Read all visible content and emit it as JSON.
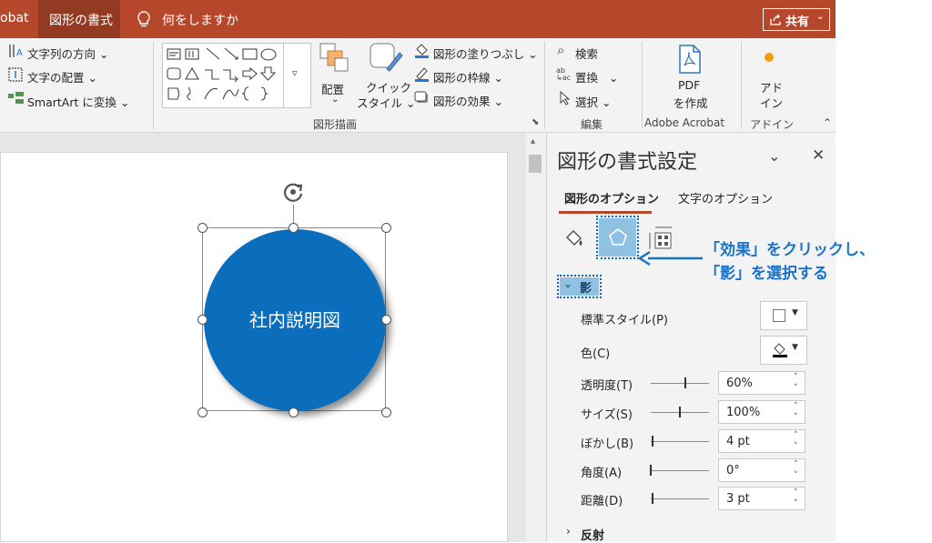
{
  "titlebar": {
    "tab_partial": "obat",
    "tab_active": "図形の書式",
    "tell_me": "何をしますか",
    "share": "共有"
  },
  "ribbon": {
    "text_direction": "文字列の方向",
    "text_align": "文字の配置",
    "smartart": "SmartArt に変換",
    "arrange": "配置",
    "quick_style_1": "クイック",
    "quick_style_2": "スタイル",
    "shape_fill": "図形の塗りつぶし",
    "shape_outline": "図形の枠線",
    "shape_effects": "図形の効果",
    "group_drawing": "図形描画",
    "find": "検索",
    "replace": "置換",
    "select": "選択",
    "group_edit": "編集",
    "pdf_1": "PDF",
    "pdf_2": "を作成",
    "group_adobe": "Adobe Acrobat",
    "addin_1": "アド",
    "addin_2": "イン",
    "group_addin": "アドイン"
  },
  "slide": {
    "shape_text": "社内説明図"
  },
  "pane": {
    "title": "図形の書式設定",
    "tab_shape_options": "図形のオプション",
    "tab_text_options": "文字のオプション",
    "section_shadow": "影",
    "preset_label": "標準スタイル(P)",
    "color_label": "色(C)",
    "transparency_label": "透明度(T)",
    "transparency_value": "60%",
    "size_label": "サイズ(S)",
    "size_value": "100%",
    "blur_label": "ぼかし(B)",
    "blur_value": "4 pt",
    "angle_label": "角度(A)",
    "angle_value": "0°",
    "distance_label": "距離(D)",
    "distance_value": "3 pt",
    "section_reflection": "反射"
  },
  "annotation": {
    "line1": "「効果」をクリックし、",
    "line2": "「影」を選択する"
  },
  "colors": {
    "accent": "#b7472a",
    "shape_fill": "#0a6ebd",
    "annotation": "#1a73c8"
  }
}
